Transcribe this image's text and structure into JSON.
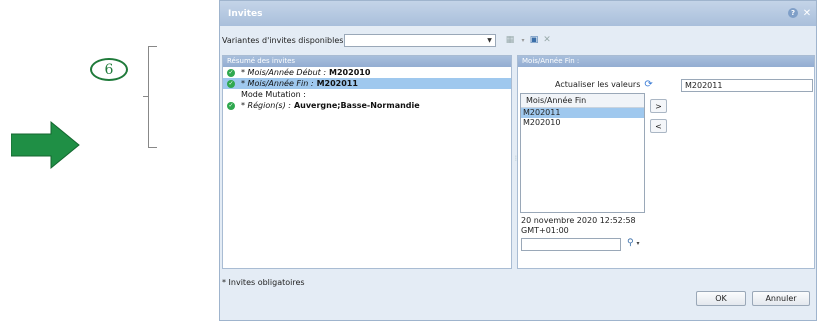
{
  "annotation": {
    "step_number": "6"
  },
  "dialog": {
    "title": "Invites",
    "title_buttons": [
      "help-icon",
      "close-icon"
    ],
    "variants_label": "Variantes d'invites disponibles",
    "variants_value": "",
    "footnote": "* Invites obligatoires",
    "ok_label": "OK",
    "cancel_label": "Annuler"
  },
  "summary": {
    "header": "Résumé des invites",
    "prompts": [
      {
        "label": "* Mois/Année Début :",
        "value": "M202010",
        "status": "ok",
        "selected": false
      },
      {
        "label": "* Mois/Année Fin :",
        "value": "M202011",
        "status": "ok",
        "selected": true
      },
      {
        "label": "Mode Mutation :",
        "value": "",
        "status": "none",
        "selected": false
      },
      {
        "label": "* Région(s) :",
        "value": "Auvergne;Basse-Normandie",
        "status": "ok",
        "selected": false
      }
    ]
  },
  "detail": {
    "header": "Mois/Année Fin :",
    "refresh_label": "Actualiser les valeurs",
    "current_value": "M202011",
    "list_header": "Mois/Année Fin",
    "list_items": [
      {
        "text": "M202011",
        "selected": true
      },
      {
        "text": "M202010",
        "selected": false
      }
    ],
    "add_label": ">",
    "remove_label": "<",
    "refresh_date": "20 novembre 2020 12:52:58",
    "refresh_tz": "GMT+01:00",
    "search_value": ""
  },
  "colors": {
    "accent_green": "#1f7a3a",
    "selection": "#9fc8ee",
    "header_blue": "#93add2"
  }
}
